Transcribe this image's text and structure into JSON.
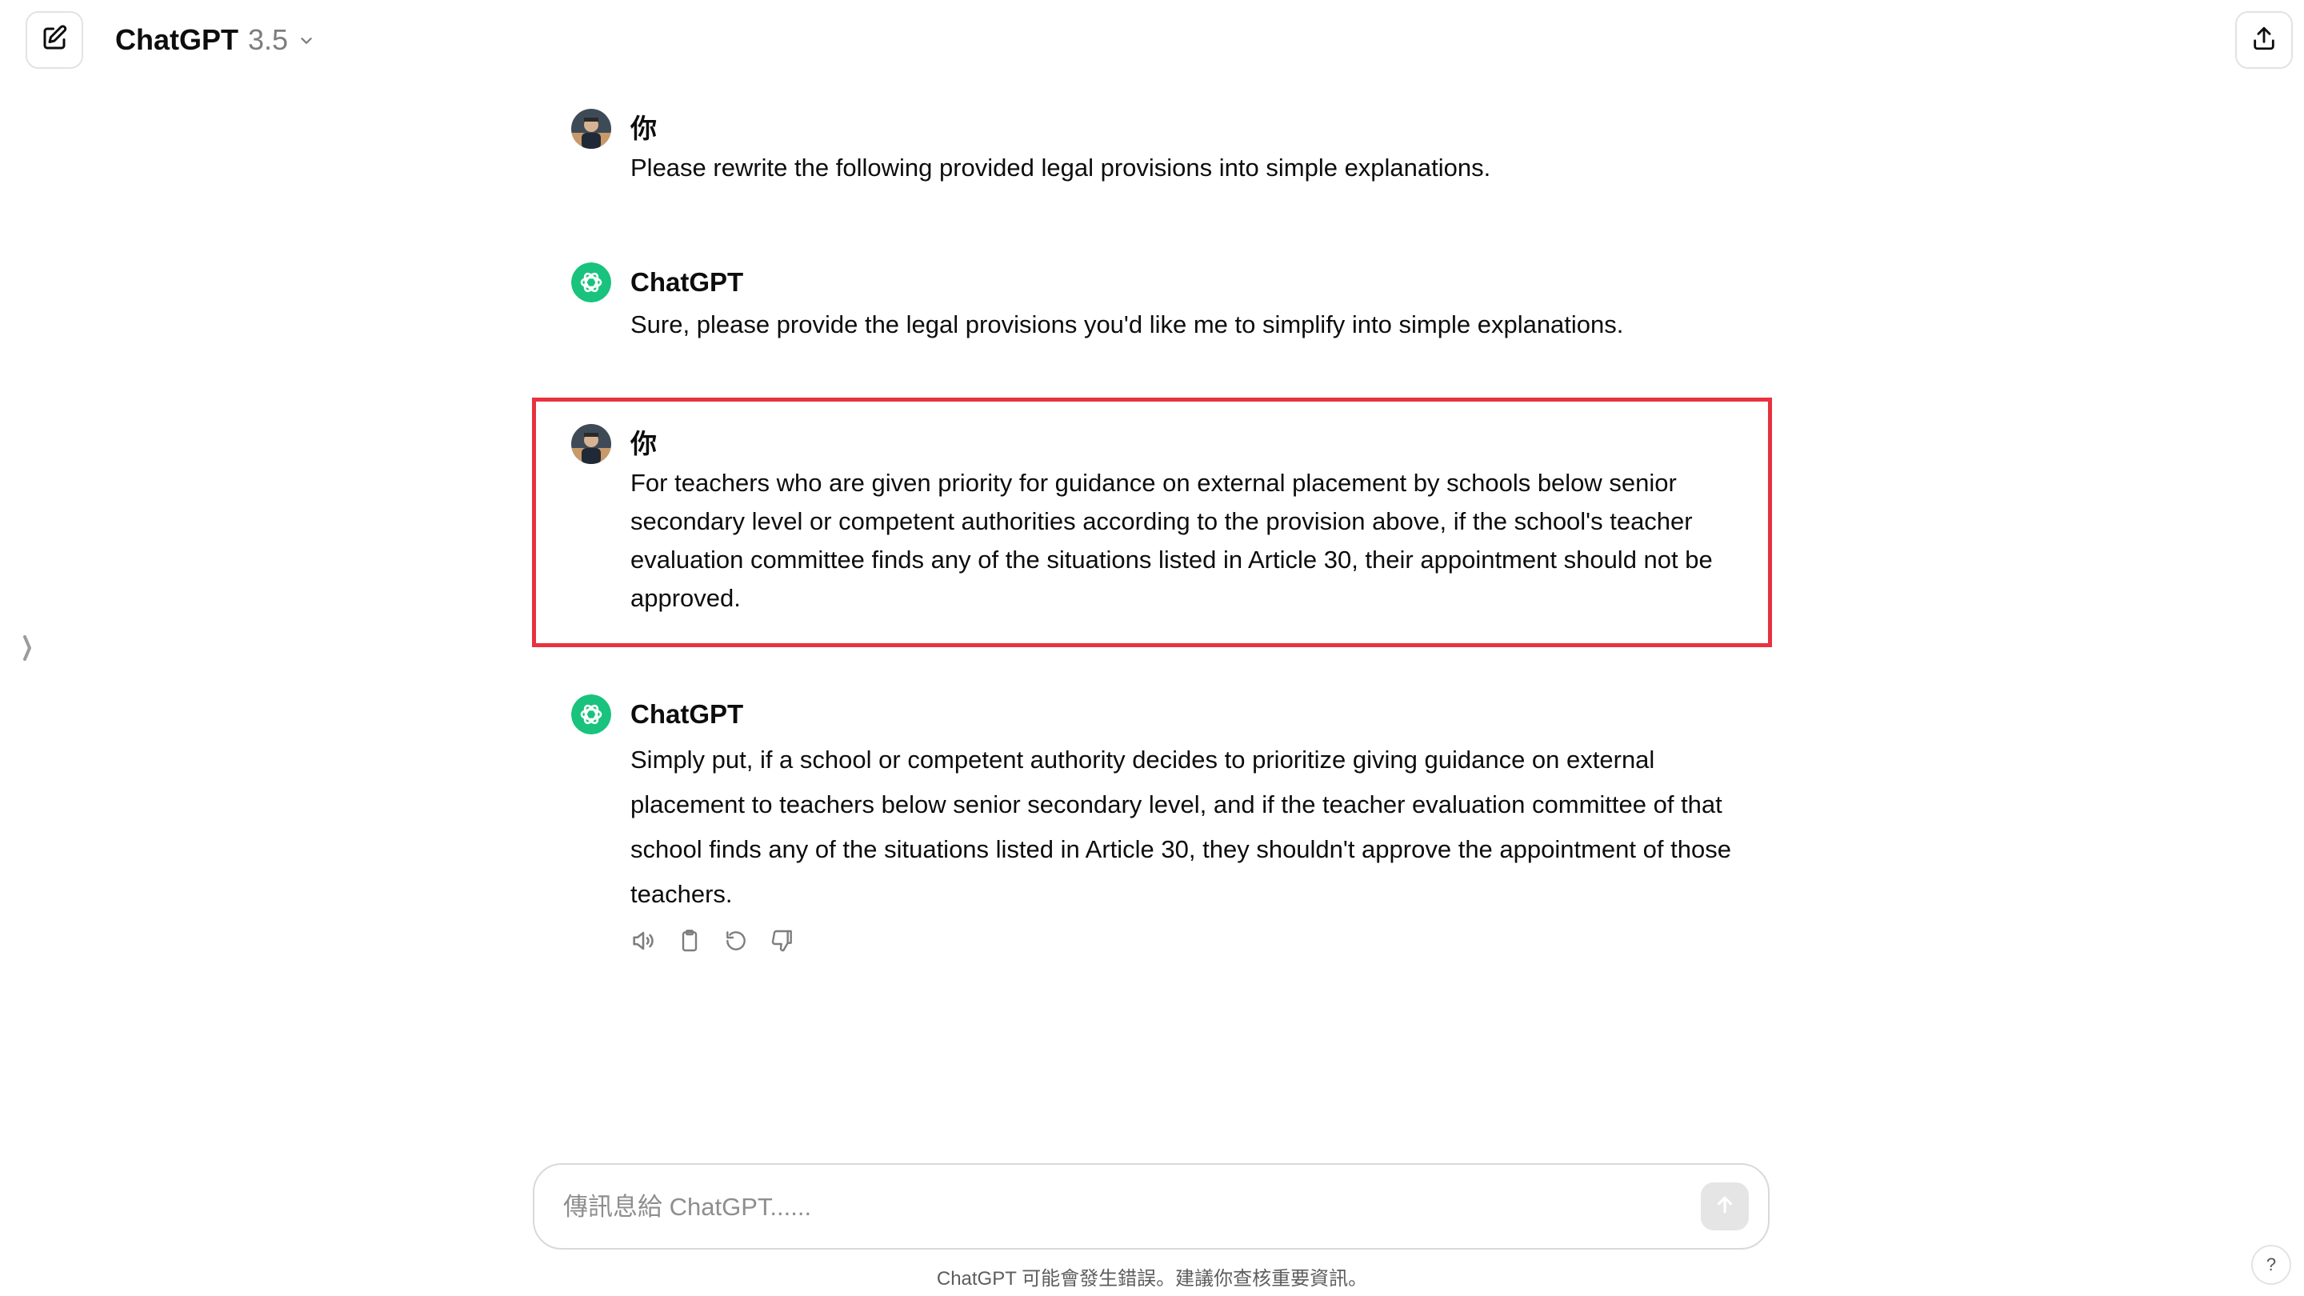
{
  "header": {
    "model_name": "ChatGPT",
    "model_version": "3.5",
    "icons": [
      "new-chat-icon",
      "chevron-down-icon",
      "share-icon"
    ]
  },
  "conversation": [
    {
      "role": "user",
      "author": "你",
      "text": "Please rewrite the following provided legal provisions into simple explanations."
    },
    {
      "role": "assistant",
      "author": "ChatGPT",
      "text": "Sure, please provide the legal provisions you'd like me to simplify into simple explanations."
    },
    {
      "role": "user",
      "author": "你",
      "text": "For teachers who are given priority for guidance on external placement by schools below senior secondary level or competent authorities according to the provision above, if the school's teacher evaluation committee finds any of the situations listed in Article 30, their appointment should not be approved."
    },
    {
      "role": "assistant",
      "author": "ChatGPT",
      "text": "Simply put, if a school or competent authority decides to prioritize giving guidance on external placement to teachers below senior secondary level, and if the teacher evaluation committee of that school finds any of the situations listed in Article 30, they shouldn't approve the appointment of those teachers."
    }
  ],
  "message_actions": [
    "read-aloud-icon",
    "copy-icon",
    "regenerate-icon",
    "thumbs-down-icon"
  ],
  "composer": {
    "placeholder": "傳訊息給 ChatGPT......",
    "value": ""
  },
  "footer": {
    "disclaimer": "ChatGPT 可能會發生錯誤。建議你查核重要資訊。",
    "help_label": "?"
  },
  "colors": {
    "highlight_border": "#e8323f",
    "assistant_logo": "#19c37d",
    "send_button_disabled": "#e5e5e5"
  }
}
